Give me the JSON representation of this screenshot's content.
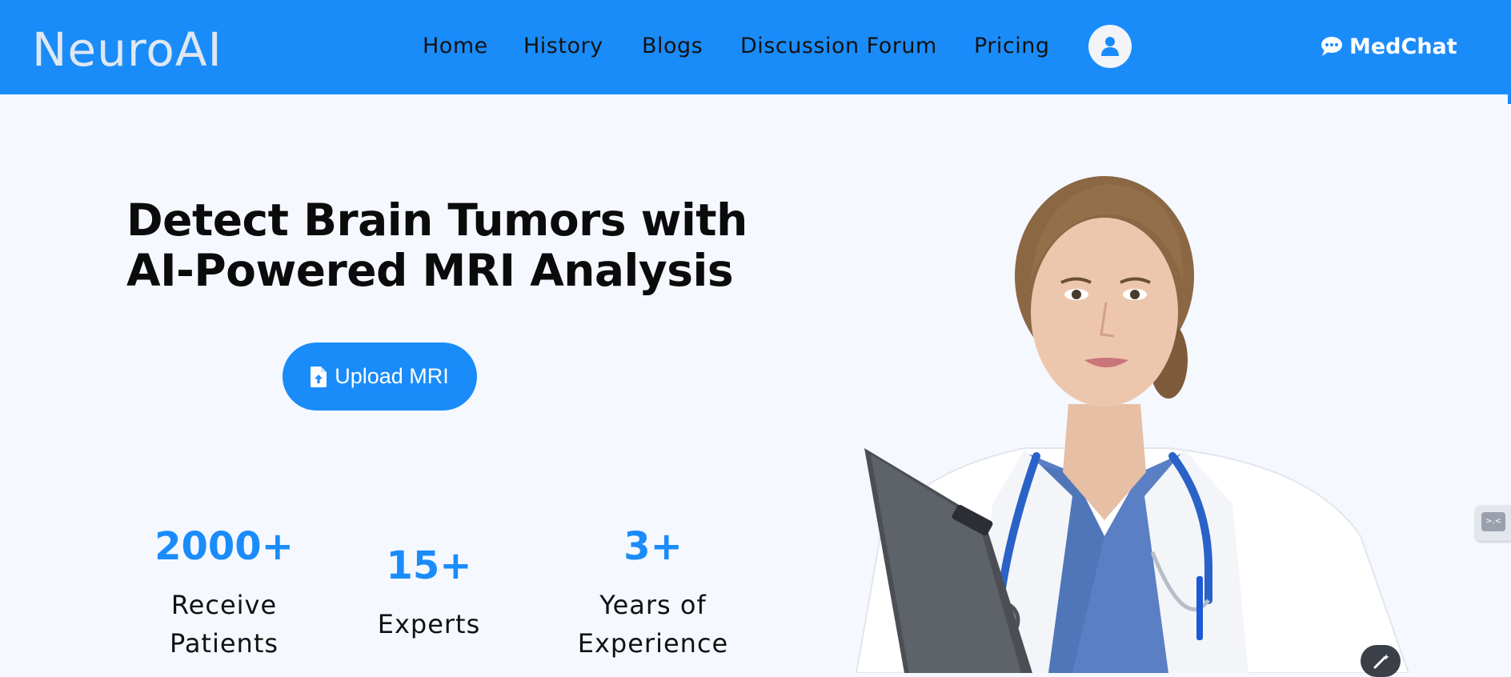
{
  "brand": "NeuroAI",
  "nav": {
    "home": "Home",
    "history": "History",
    "blogs": "Blogs",
    "forum": "Discussion Forum",
    "pricing": "Pricing",
    "medchat": "MedChat"
  },
  "hero": {
    "title_line1": "Detect Brain Tumors with",
    "title_line2": "AI-Powered MRI Analysis",
    "upload_label": "Upload MRI"
  },
  "stats": [
    {
      "number": "2000+",
      "label_line1": "Receive",
      "label_line2": "Patients"
    },
    {
      "number": "15+",
      "label_line1": "Experts",
      "label_line2": ""
    },
    {
      "number": "3+",
      "label_line1": "Years of",
      "label_line2": "Experience"
    }
  ],
  "colors": {
    "primary": "#1a8cfa",
    "background": "#f5f8ff",
    "brand_text": "#dfe7f2",
    "nav_text": "#121212"
  },
  "icons": {
    "avatar": "user-icon",
    "medchat": "chat-bubble-icon",
    "upload": "file-upload-icon",
    "widget": "extension-widget-icon",
    "magic": "magic-wand-icon"
  }
}
